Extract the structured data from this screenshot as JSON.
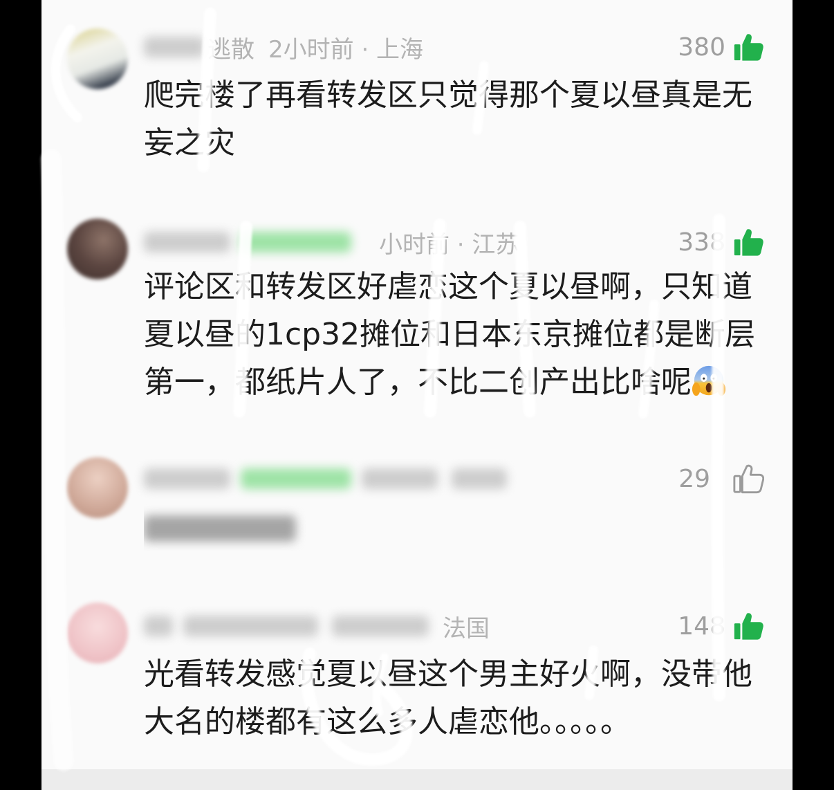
{
  "colors": {
    "like_green": "#22b14c",
    "text": "#1c1c1c",
    "meta": "#b3b3b3",
    "count": "#9e9e9e",
    "screen_background": "#fafafa"
  },
  "comments": [
    {
      "username": "逃散",
      "time_location": "2小时前 · 上海",
      "likes": "380",
      "liked": true,
      "like_icon": "thumbs-up-filled-icon",
      "content_lines": [
        "爬完楼了再看转发区只觉得那个夏以昼真是无",
        "妄之灾"
      ]
    },
    {
      "time_location": "小时前 · 江苏",
      "likes": "338",
      "liked": true,
      "like_icon": "thumbs-up-filled-icon",
      "content_lines": [
        "评论区和转发区好虐恋这个夏以昼啊，只知道",
        "夏以昼的1cp32摊位和日本东京摊位都是断层",
        "第一，都纸片人了，不比二创产出比啥呢"
      ],
      "content_emoji": "face-screaming-in-fear-icon"
    },
    {
      "likes": "29",
      "liked": false,
      "like_icon": "thumbs-up-outline-icon"
    },
    {
      "location": "法国",
      "likes": "148",
      "liked": true,
      "like_icon": "thumbs-up-filled-icon",
      "content_lines": [
        "光看转发感觉夏以昼这个男主好火啊，没带他",
        "大名的楼都有这么多人虐恋他。。。。。"
      ]
    }
  ]
}
